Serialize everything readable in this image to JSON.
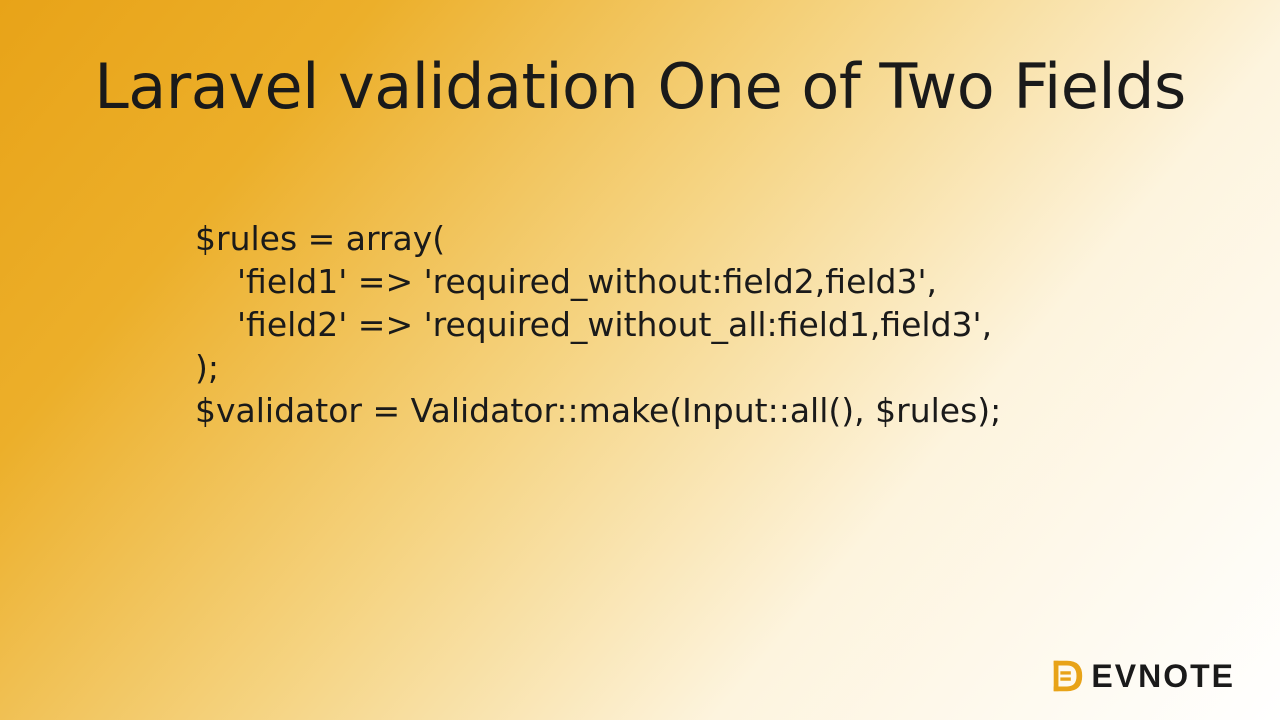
{
  "title": "Laravel validation One of Two Fields",
  "code": {
    "line1": "$rules = array(",
    "line2": "    'field1' => 'required_without:field2,field3',",
    "line3": "    'field2' => 'required_without_all:field1,field3',",
    "line4": ");",
    "line5": "",
    "line6": "$validator = Validator::make(Input::all(), $rules);"
  },
  "brand": {
    "text": "EVNOTE"
  }
}
